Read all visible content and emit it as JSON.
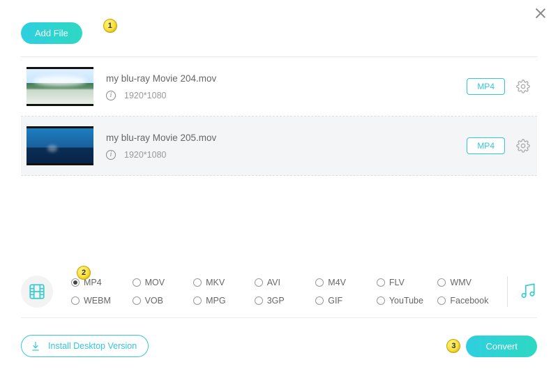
{
  "buttons": {
    "add_file": "Add File",
    "install": "Install Desktop Version",
    "convert": "Convert"
  },
  "steps": {
    "s1": "1",
    "s2": "2",
    "s3": "3"
  },
  "files": [
    {
      "name": "my blu-ray Movie 204.mov",
      "resolution": "1920*1080",
      "format": "MP4"
    },
    {
      "name": "my blu-ray Movie 205.mov",
      "resolution": "1920*1080",
      "format": "MP4"
    }
  ],
  "formats": {
    "row1": [
      "MP4",
      "MOV",
      "MKV",
      "AVI",
      "M4V",
      "FLV",
      "WMV"
    ],
    "row2": [
      "WEBM",
      "VOB",
      "MPG",
      "3GP",
      "GIF",
      "YouTube",
      "Facebook"
    ],
    "selected": "MP4"
  }
}
